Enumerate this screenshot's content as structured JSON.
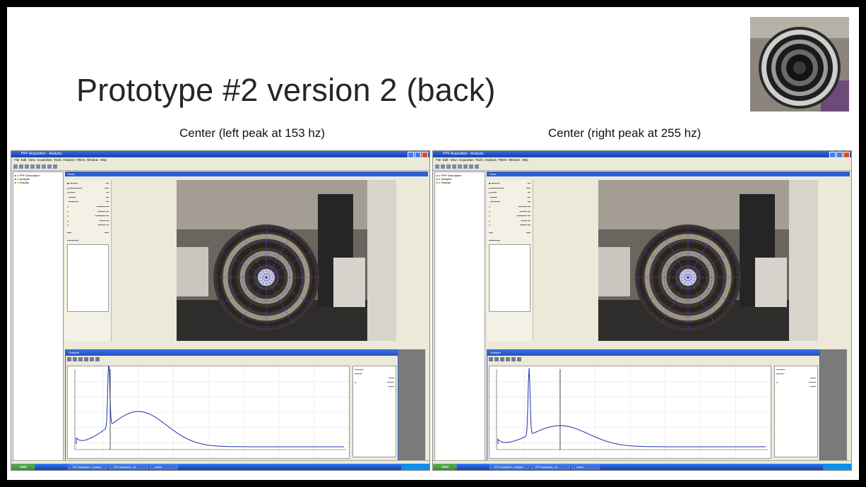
{
  "slide": {
    "title": "Prototype #2 version 2 (back)",
    "caption_left": "Center (left peak at 153 hz)",
    "caption_right": "Center (right peak at 255 hz)"
  },
  "app": {
    "window_title": "PPF Acquisition - Analysis",
    "menu": [
      "File",
      "Edit",
      "View",
      "Acquisition",
      "Tools",
      "Analysis",
      "Filters",
      "Window",
      "Help"
    ],
    "tree": [
      "PPF Description",
      "Analysis",
      "Display"
    ],
    "panel_title": "Scan",
    "spectrum_title": "Analysis",
    "start_label": "start",
    "tasks": [
      "PPF Acquisition - Analysis",
      "PPF Acquisition - [G...",
      "Adobe"
    ]
  },
  "colors": {
    "xp_blue": "#2b5fd0",
    "curve": "#2233aa",
    "peak_marker": "#222222"
  },
  "icons": [
    "window-minimize-icon",
    "window-maximize-icon",
    "window-close-icon",
    "folder-icon",
    "toolbar-icon",
    "start-icon"
  ]
}
